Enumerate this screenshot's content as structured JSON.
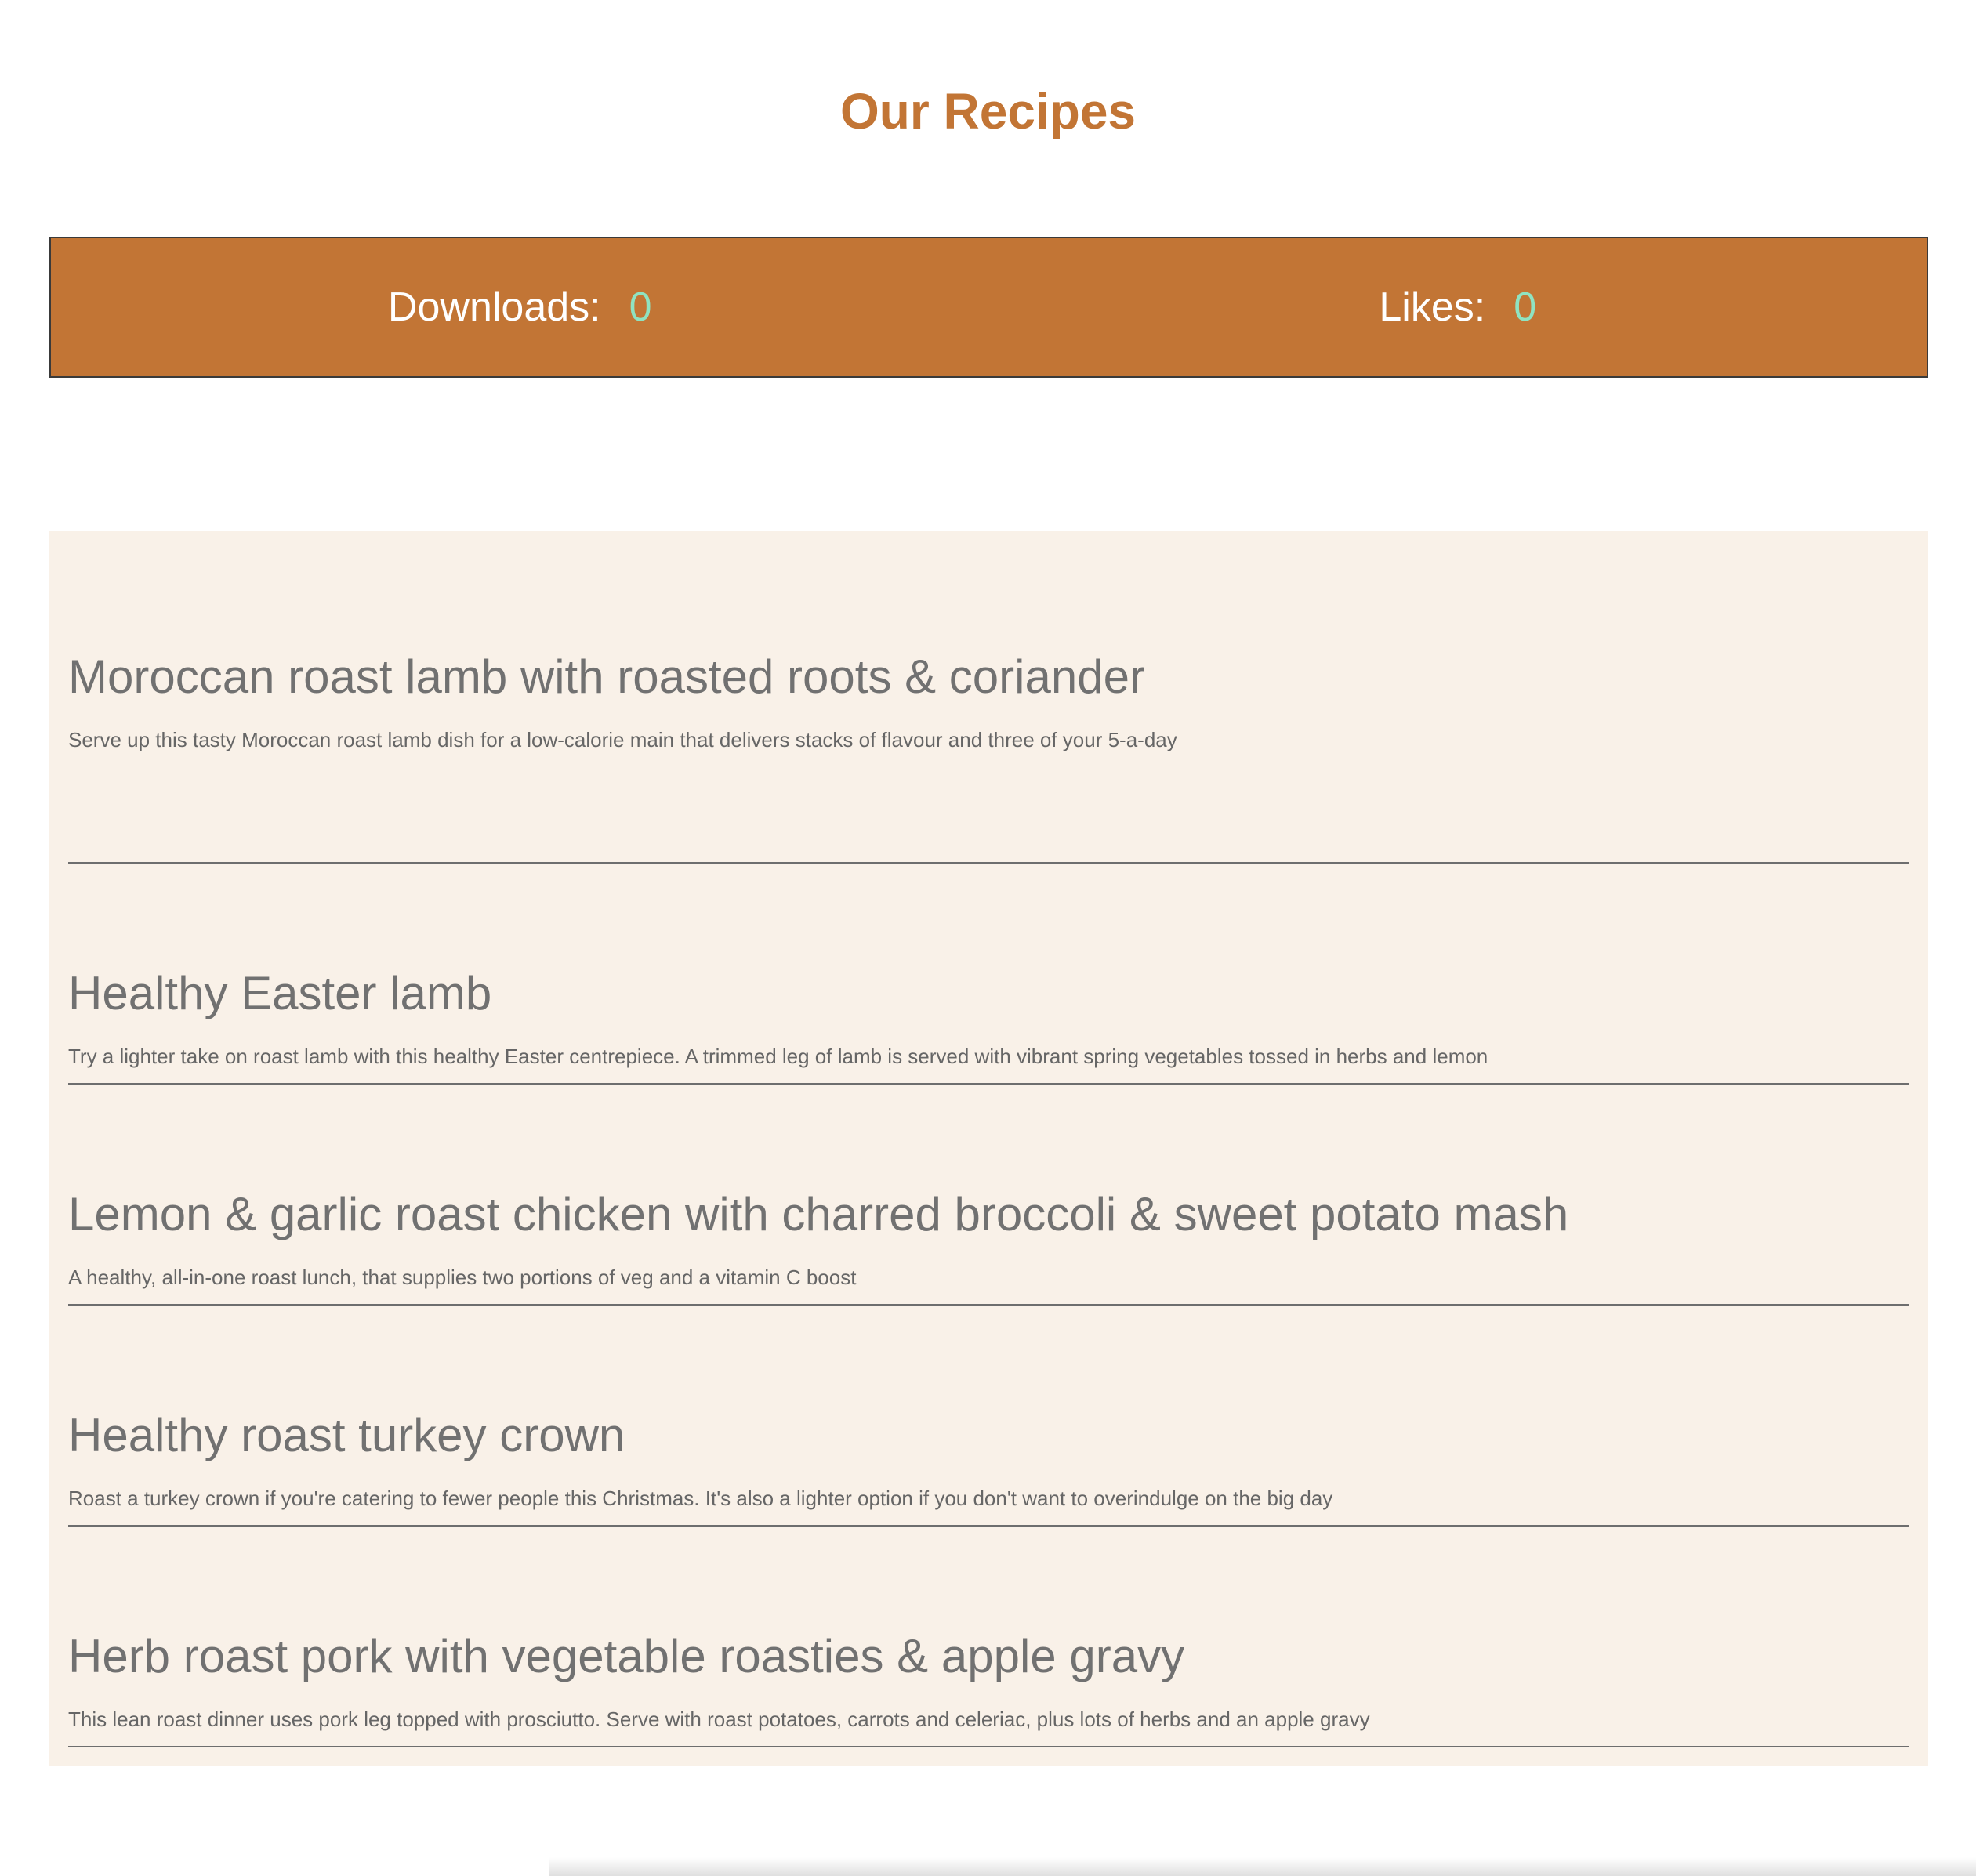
{
  "page": {
    "title": "Our Recipes"
  },
  "stats": {
    "downloads_label": "Downloads:",
    "downloads_value": "0",
    "likes_label": "Likes:",
    "likes_value": "0"
  },
  "recipes": [
    {
      "title": "Moroccan roast lamb with roasted roots & coriander",
      "description": "Serve up this tasty Moroccan roast lamb dish for a low-calorie main that delivers stacks of flavour and three of your 5-a-day"
    },
    {
      "title": "Healthy Easter lamb",
      "description": "Try a lighter take on roast lamb with this healthy Easter centrepiece. A trimmed leg of lamb is served with vibrant spring vegetables tossed in herbs and lemon"
    },
    {
      "title": "Lemon & garlic roast chicken with charred broccoli & sweet potato mash",
      "description": "A healthy, all-in-one roast lunch, that supplies two portions of veg and a vitamin C boost"
    },
    {
      "title": "Healthy roast turkey crown",
      "description": "Roast a turkey crown if you're catering to fewer people this Christmas. It's also a lighter option if you don't want to overindulge on the big day"
    },
    {
      "title": "Herb roast pork with vegetable roasties & apple gravy",
      "description": "This lean roast dinner uses pork leg topped with prosciutto. Serve with roast potatoes, carrots and celeriac, plus lots of herbs and an apple gravy"
    }
  ],
  "colors": {
    "accent": "#c27535",
    "stat_value": "#8fe3c1",
    "panel_background": "#f9f1e8",
    "recipe_text": "#717171"
  }
}
